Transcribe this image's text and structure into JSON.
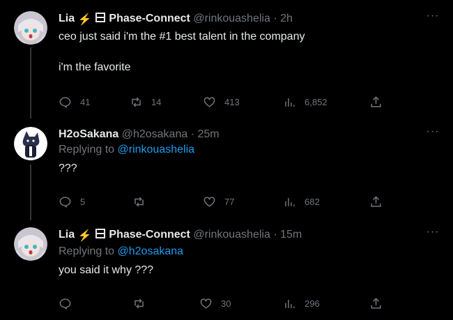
{
  "tweets": [
    {
      "name": "Lia",
      "badge1": "⚡",
      "affiliation": "Phase-Connect",
      "handle": "@rinkouashelia",
      "time": "2h",
      "lines": [
        "ceo just said i'm the #1 best talent in the company",
        "i'm the favorite"
      ],
      "replies": "41",
      "reposts": "14",
      "likes": "413",
      "views": "6,852"
    },
    {
      "name": "H2oSakana",
      "handle": "@h2osakana",
      "time": "25m",
      "replying_prefix": "Replying to",
      "replying_to": "@rinkouashelia",
      "text": "???",
      "replies": "5",
      "reposts": "",
      "likes": "77",
      "views": "682"
    },
    {
      "name": "Lia",
      "badge1": "⚡",
      "affiliation": "Phase-Connect",
      "handle": "@rinkouashelia",
      "time": "15m",
      "replying_prefix": "Replying to",
      "replying_to": "@h2osakana",
      "text": "you said it why ???",
      "replies": "",
      "reposts": "",
      "likes": "30",
      "views": "296"
    }
  ],
  "separator": "·",
  "more_glyph": "···",
  "colors": {
    "background": "#000000",
    "text": "#e7e9ea",
    "secondary": "#71767b",
    "link": "#1d9bf0",
    "lightning": "#f4b400"
  },
  "icons": [
    "reply-icon",
    "repost-icon",
    "like-icon",
    "views-icon",
    "share-icon",
    "more-icon",
    "lightning-icon",
    "affiliation-badge-icon"
  ]
}
